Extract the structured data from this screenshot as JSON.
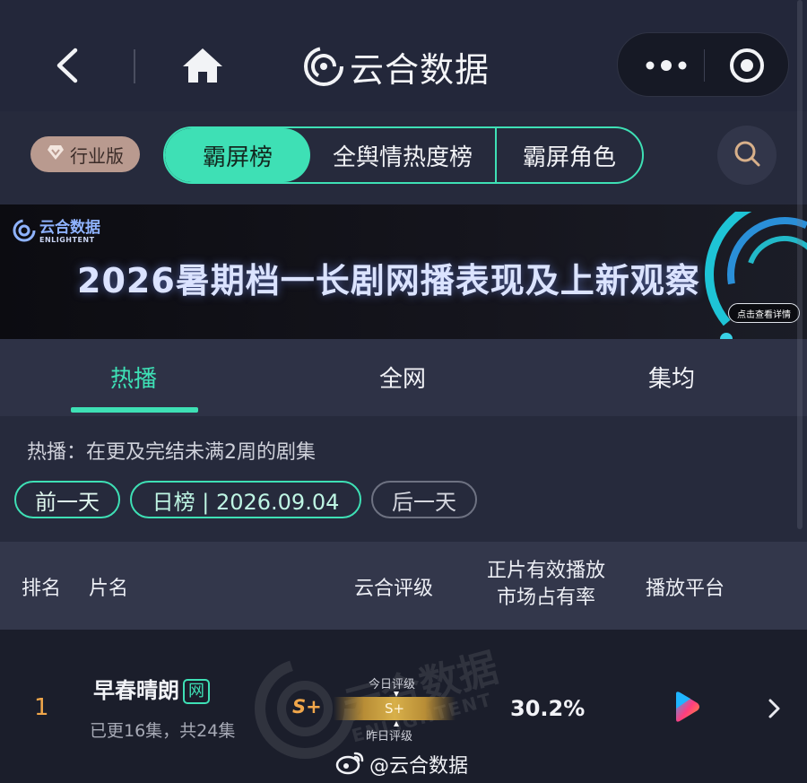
{
  "app": {
    "title": "云合数据"
  },
  "filter": {
    "industry_label": "行业版",
    "segments": [
      "霸屏榜",
      "全舆情热度榜",
      "霸屏角色"
    ]
  },
  "banner": {
    "logo_cn": "云合数据",
    "logo_en": "ENLIGHTENT",
    "title": "2026暑期档一长剧网播表现及上新观察",
    "cta": "点击查看详情"
  },
  "tabs": [
    "热播",
    "全网",
    "集均"
  ],
  "info": {
    "description": "热播：在更及完结未满2周的剧集",
    "prev_day": "前一天",
    "date_label": "日榜 | 2026.09.04",
    "next_day": "后一天"
  },
  "table": {
    "headers": {
      "rank": "排名",
      "title": "片名",
      "grade": "云合评级",
      "share_line1": "正片有效播放",
      "share_line2": "市场占有率",
      "platform": "播放平台"
    },
    "rows": [
      {
        "rank": "1",
        "title": "早春晴朗",
        "badge": "网",
        "episodes": "已更16集，共24集",
        "grade_today": "S+",
        "grade_label_top": "今日评级",
        "grade_bar": "S+",
        "grade_label_bottom": "昨日评级",
        "share": "30.2%",
        "platform_icon": "youku-play-icon"
      }
    ]
  },
  "watermark": {
    "cn": "云合数据",
    "en": "ENLIGHTENT"
  },
  "weibo_handle": "@云合数据",
  "colors": {
    "accent": "#3ee0b5",
    "rank_orange": "#f0a64a",
    "background": "#1e2130"
  }
}
